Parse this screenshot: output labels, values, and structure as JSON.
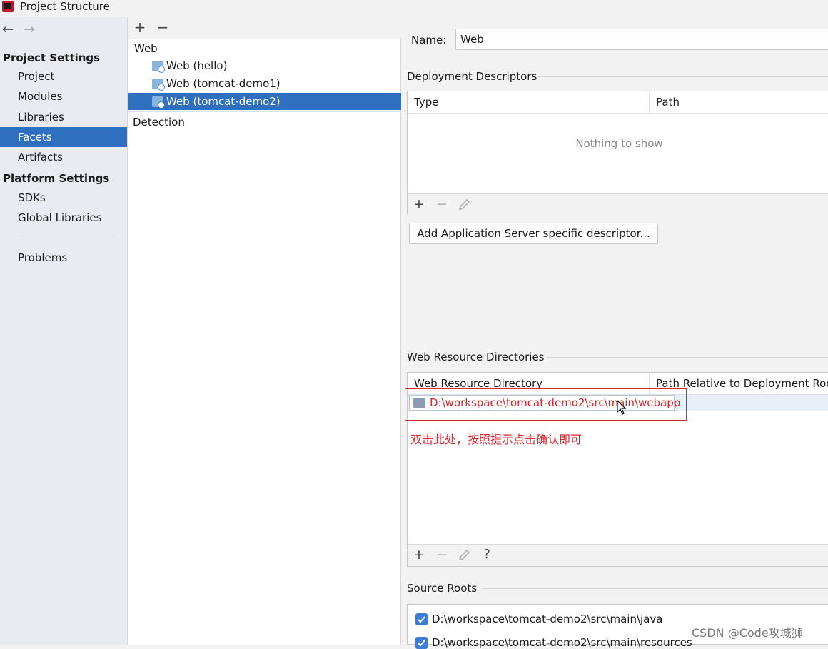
{
  "window": {
    "title": "Project Structure"
  },
  "sidebar": {
    "project_settings_header": "Project Settings",
    "platform_settings_header": "Platform Settings",
    "items": [
      "Project",
      "Modules",
      "Libraries",
      "Facets",
      "Artifacts"
    ],
    "platform_items": [
      "SDKs",
      "Global Libraries"
    ],
    "problems": "Problems",
    "selected": "Facets"
  },
  "facets": {
    "add_label": "+",
    "remove_label": "−",
    "group": "Web",
    "items": [
      "Web (hello)",
      "Web (tomcat-demo1)",
      "Web (tomcat-demo2)"
    ],
    "selected": "Web (tomcat-demo2)",
    "detection": "Detection"
  },
  "detail": {
    "name_label": "Name:",
    "name_value": "Web",
    "deployment": {
      "title": "Deployment Descriptors",
      "col_type": "Type",
      "col_path": "Path",
      "empty": "Nothing to show"
    },
    "add_server_button": "Add Application Server specific descriptor...",
    "web_resources": {
      "title": "Web Resource Directories",
      "col_directory": "Web Resource Directory",
      "col_relative": "Path Relative to Deployment Roo",
      "row_path": "D:\\workspace\\tomcat-demo2\\src\\main\\webapp"
    },
    "help_label": "?",
    "annotation": "双击此处，按照提示点击确认即可",
    "source_roots": {
      "title": "Source Roots",
      "items": [
        "D:\\workspace\\tomcat-demo2\\src\\main\\java",
        "D:\\workspace\\tomcat-demo2\\src\\main\\resources"
      ]
    }
  },
  "watermark": "CSDN @Code攻城狮",
  "colors": {
    "selection": "#2f6fbf",
    "annotation_red": "#e0222a",
    "checkbox": "#3d7dd6"
  }
}
